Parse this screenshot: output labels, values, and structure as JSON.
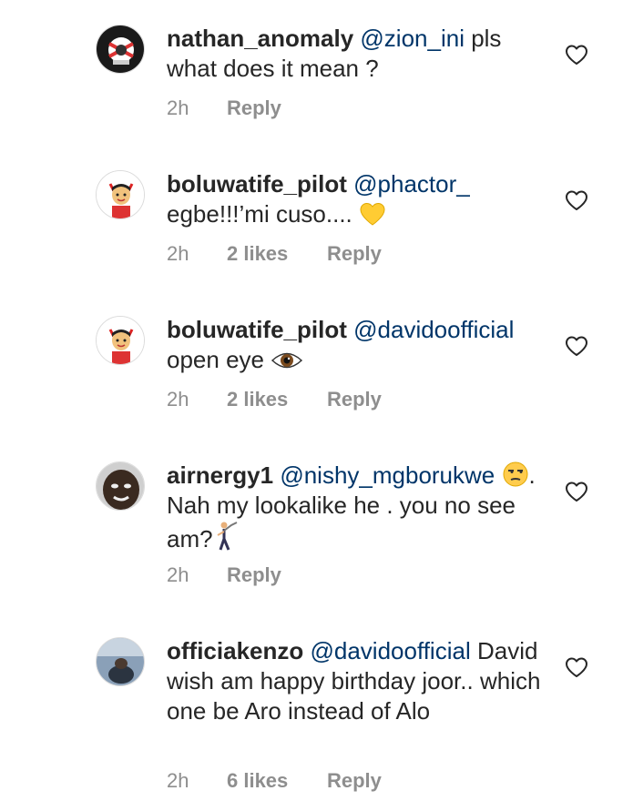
{
  "comments": [
    {
      "username": "nathan_anomaly",
      "mention": "@zion_ini",
      "text_a": " pls what does it mean ?",
      "time": "2h",
      "likes": "",
      "reply": "Reply"
    },
    {
      "username": "boluwatife_pilot",
      "mention": "@phactor_",
      "text_a": " egbe!!!’mi cuso.... ",
      "time": "2h",
      "likes": "2 likes",
      "reply": "Reply"
    },
    {
      "username": "boluwatife_pilot",
      "mention": "@davidoofficial",
      "text_a": " open eye ",
      "time": "2h",
      "likes": "2 likes",
      "reply": "Reply"
    },
    {
      "username": "airnergy1",
      "mention": "@nishy_mgborukwe",
      "text_a": ". Nah my lookalike he . you no see am?",
      "time": "2h",
      "likes": "",
      "reply": "Reply"
    },
    {
      "username": "officiakenzo",
      "mention": "@davidoofficial",
      "text_a": " David wish am happy birthday joor.. which one be Aro instead of Alo",
      "time": "2h",
      "likes": "6 likes",
      "reply": "Reply"
    }
  ],
  "icons": {
    "heart": "heart-outline-icon",
    "yellow_heart": "yellow-heart-emoji",
    "eye": "eye-emoji",
    "unamused": "unamused-face-emoji",
    "golfer": "golfer-emoji"
  },
  "colors": {
    "text": "#262626",
    "mention": "#003569",
    "meta": "#8e8e8e"
  }
}
